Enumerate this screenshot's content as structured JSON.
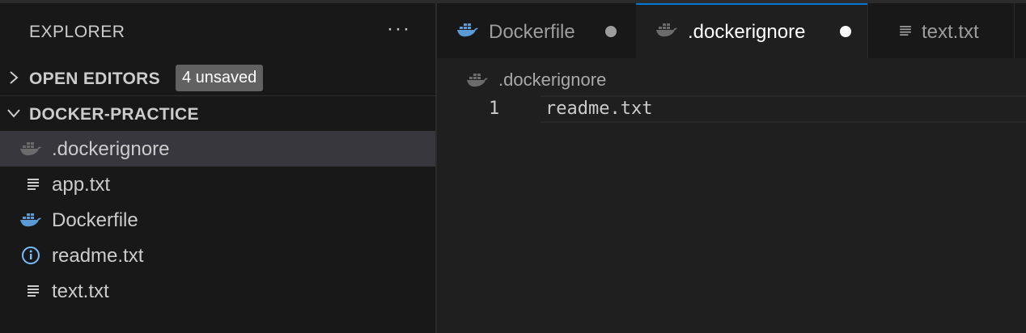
{
  "sidebar": {
    "header": "EXPLORER",
    "more_label": "···",
    "open_editors": {
      "title": "OPEN EDITORS",
      "badge": "4 unsaved",
      "expanded": false
    },
    "workspace": {
      "title": "DOCKER-PRACTICE",
      "expanded": true
    },
    "files": [
      {
        "name": ".dockerignore",
        "icon": "docker-icon-muted",
        "selected": true
      },
      {
        "name": "app.txt",
        "icon": "text-file-icon",
        "selected": false
      },
      {
        "name": "Dockerfile",
        "icon": "docker-icon",
        "selected": false
      },
      {
        "name": "readme.txt",
        "icon": "info-icon",
        "selected": false
      },
      {
        "name": "text.txt",
        "icon": "text-file-icon",
        "selected": false
      }
    ]
  },
  "tabs": [
    {
      "label": "Dockerfile",
      "icon": "docker-icon",
      "unsaved": true,
      "active": false
    },
    {
      "label": ".dockerignore",
      "icon": "docker-icon-muted",
      "unsaved": true,
      "active": true
    },
    {
      "label": "text.txt",
      "icon": "text-file-icon",
      "unsaved": false,
      "active": false
    }
  ],
  "breadcrumb": {
    "file": ".dockerignore",
    "icon": "docker-icon-muted"
  },
  "editor": {
    "lines": [
      {
        "number": "1",
        "text": "readme.txt"
      }
    ]
  },
  "colors": {
    "background": "#181818",
    "editor_bg": "#1f1f1f",
    "selected_row": "#37373d",
    "accent_tab_border": "#0078d4",
    "docker_blue": "#5b9bd5",
    "docker_muted": "#6b6b6b",
    "info_blue": "#75beff",
    "badge_bg": "#616161"
  }
}
